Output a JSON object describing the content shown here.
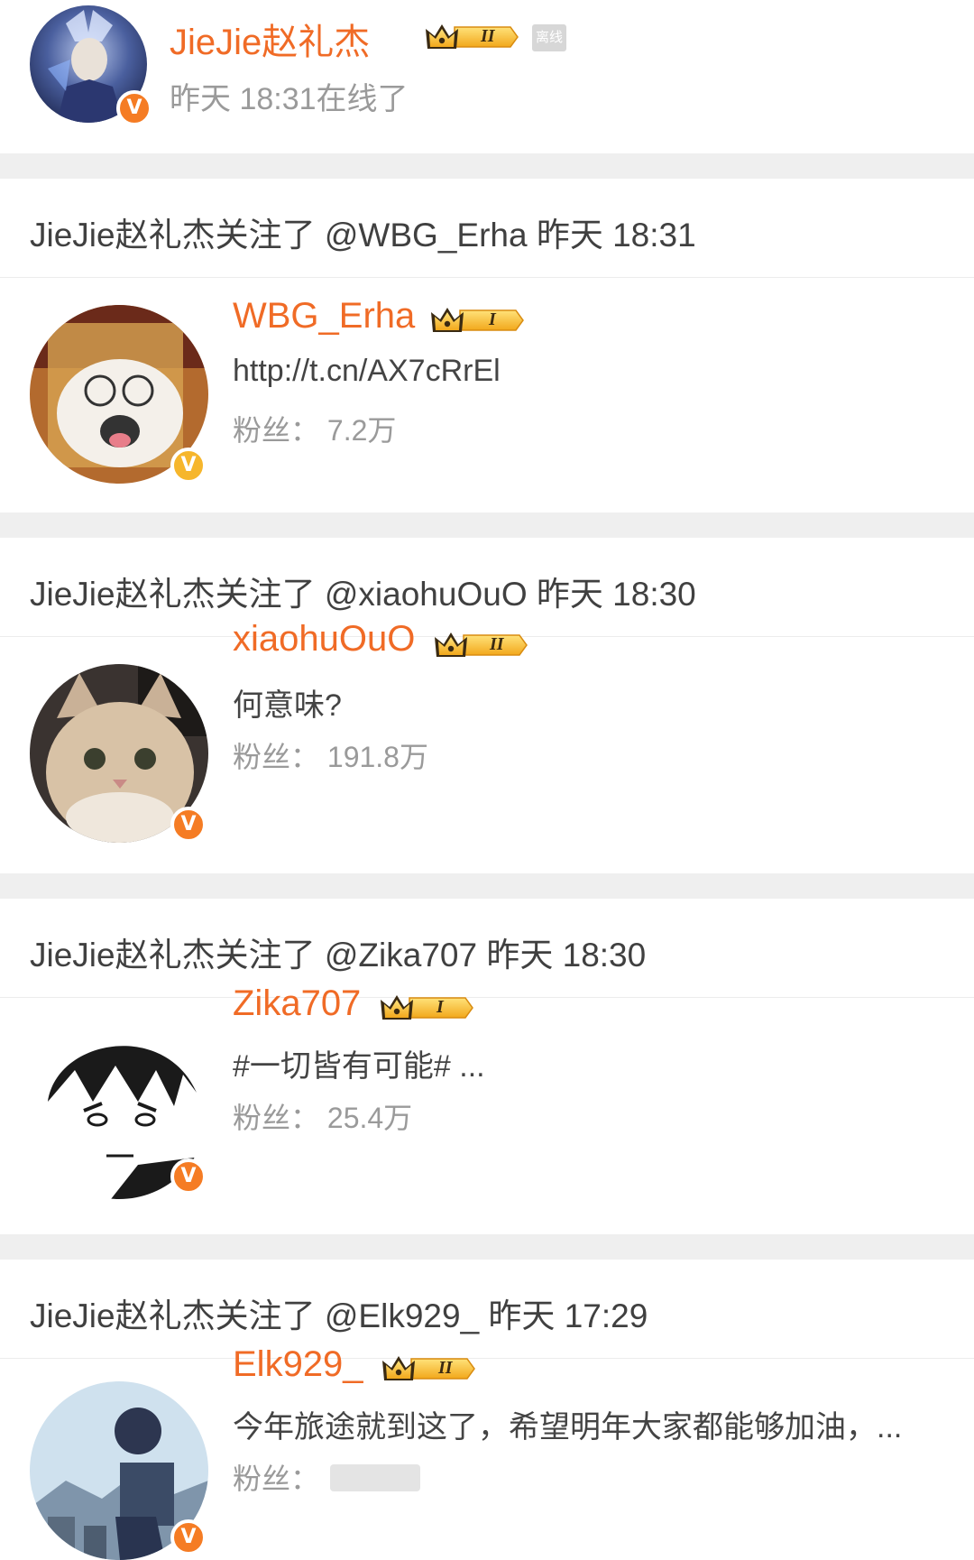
{
  "profile": {
    "name": "JieJie赵礼杰",
    "level": "II",
    "status_badge": "离线",
    "last_online": "昨天 18:31在线了"
  },
  "follows": [
    {
      "header": "JieJie赵礼杰关注了 @WBG_Erha 昨天 18:31",
      "name": "WBG_Erha",
      "level": "I",
      "bio": "http://t.cn/AX7cRrEl",
      "fans": "粉丝：  7.2万",
      "badge": "gold"
    },
    {
      "header": "JieJie赵礼杰关注了 @xiaohuOuO 昨天 18:30",
      "name": "xiaohuOuO",
      "level": "II",
      "bio": "何意味?",
      "fans": "粉丝：  191.8万",
      "badge": "orange"
    },
    {
      "header": "JieJie赵礼杰关注了 @Zika707 昨天 18:30",
      "name": "Zika707",
      "level": "I",
      "bio": "#一切皆有可能# ...",
      "fans": "粉丝：  25.4万",
      "badge": "orange"
    },
    {
      "header": "JieJie赵礼杰关注了 @Elk929_ 昨天 17:29",
      "name": "Elk929_",
      "level": "II",
      "bio": "今年旅途就到这了，希望明年大家都能够加油，...",
      "fans": "粉丝：",
      "badge": "orange"
    }
  ],
  "colors": {
    "name": "#f06b26",
    "verified_orange": "#f57c24",
    "verified_gold": "#f6b62c",
    "gap": "#efefef"
  }
}
